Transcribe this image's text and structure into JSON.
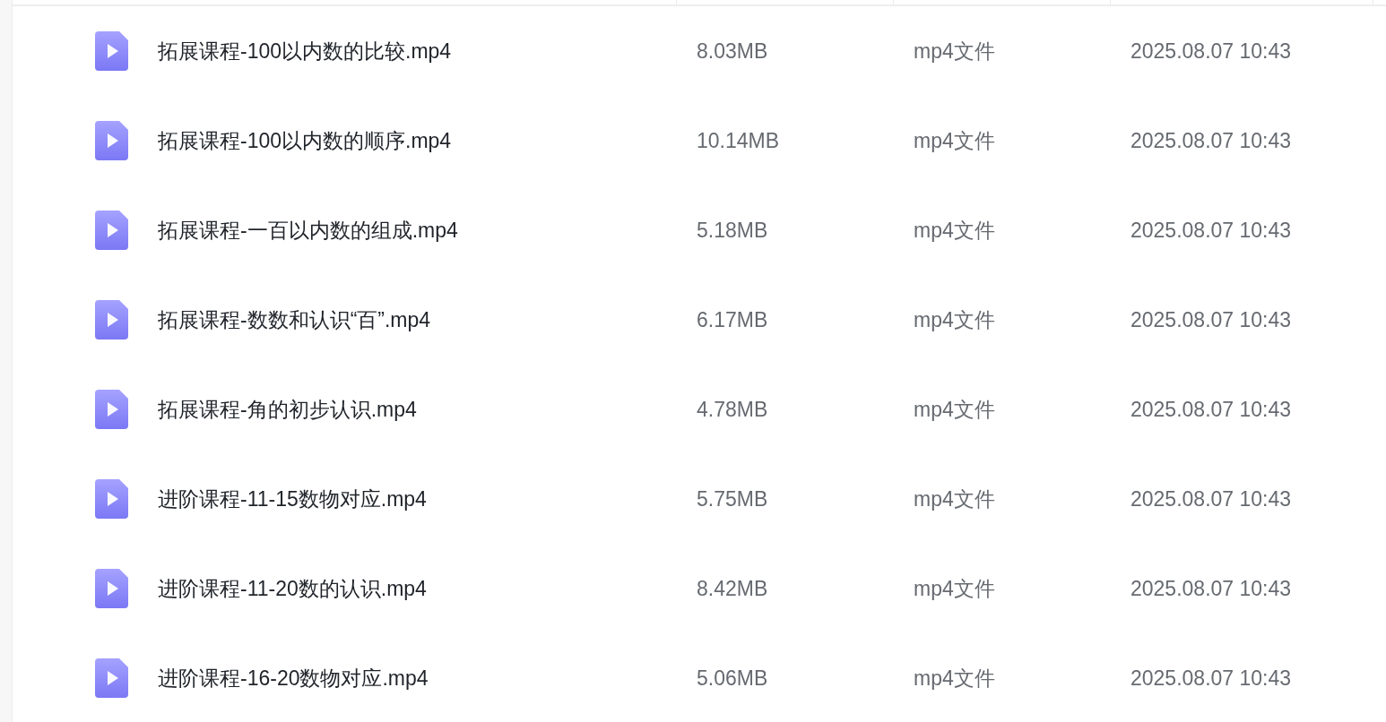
{
  "files": [
    {
      "name": "拓展课程-100以内数的比较.mp4",
      "size": "8.03MB",
      "type": "mp4文件",
      "modified": "2025.08.07 10:43"
    },
    {
      "name": "拓展课程-100以内数的顺序.mp4",
      "size": "10.14MB",
      "type": "mp4文件",
      "modified": "2025.08.07 10:43"
    },
    {
      "name": "拓展课程-一百以内数的组成.mp4",
      "size": "5.18MB",
      "type": "mp4文件",
      "modified": "2025.08.07 10:43"
    },
    {
      "name": "拓展课程-数数和认识“百”.mp4",
      "size": "6.17MB",
      "type": "mp4文件",
      "modified": "2025.08.07 10:43"
    },
    {
      "name": "拓展课程-角的初步认识.mp4",
      "size": "4.78MB",
      "type": "mp4文件",
      "modified": "2025.08.07 10:43"
    },
    {
      "name": "进阶课程-11-15数物对应.mp4",
      "size": "5.75MB",
      "type": "mp4文件",
      "modified": "2025.08.07 10:43"
    },
    {
      "name": "进阶课程-11-20数的认识.mp4",
      "size": "8.42MB",
      "type": "mp4文件",
      "modified": "2025.08.07 10:43"
    },
    {
      "name": "进阶课程-16-20数物对应.mp4",
      "size": "5.06MB",
      "type": "mp4文件",
      "modified": "2025.08.07 10:43"
    }
  ]
}
